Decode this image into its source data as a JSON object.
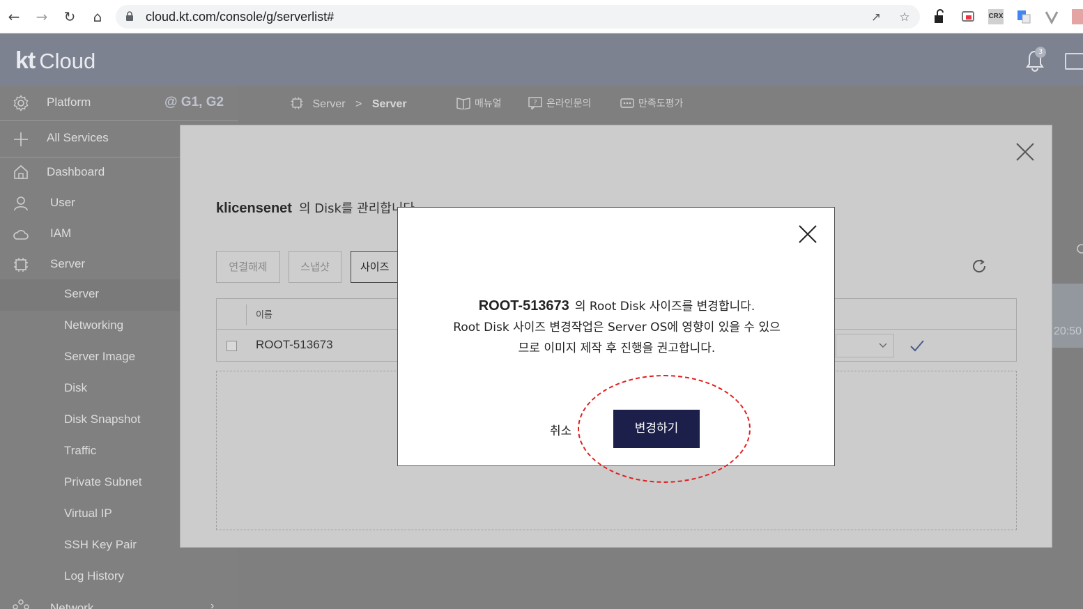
{
  "browser": {
    "url": "cloud.kt.com/console/g/serverlist#",
    "extensions": [
      "CRX"
    ]
  },
  "header": {
    "logo_kt": "kt",
    "logo_cloud": "Cloud",
    "notification_count": "3"
  },
  "sidebar": {
    "platform_label": "Platform",
    "platform_tag": "@ G1, G2",
    "all_services": "All Services",
    "items": [
      {
        "label": "Dashboard",
        "icon": "home-icon"
      },
      {
        "label": "User",
        "icon": "user-icon"
      },
      {
        "label": "IAM",
        "icon": "cloud-icon"
      },
      {
        "label": "Server",
        "icon": "chip-icon"
      }
    ],
    "server_sub": [
      "Server",
      "Networking",
      "Server Image",
      "Disk",
      "Disk Snapshot",
      "Traffic",
      "Private Subnet",
      "Virtual IP",
      "SSH Key Pair",
      "Log History"
    ],
    "network": "Network"
  },
  "main": {
    "crumb_root": "Server",
    "crumb_sep": ">",
    "crumb_current": "Server",
    "link_manual": "매뉴얼",
    "link_inquiry": "온라인문의",
    "link_survey": "만족도평가",
    "side_time": "20:50"
  },
  "disk_modal": {
    "server_name": "klicensenet",
    "title_suffix": "의 Disk를 관리합니다",
    "btn_detach": "연결해제",
    "btn_snapshot": "스냅샷",
    "btn_resize": "사이즈변경",
    "col_name": "이름",
    "row_name": "ROOT-513673"
  },
  "confirm": {
    "disk_name": "ROOT-513673",
    "line1": "의 Root Disk 사이즈를 변경합니다.",
    "line2": "Root Disk 사이즈 변경작업은 Server OS에 영향이 있을 수 있으",
    "line3": "므로 이미지 제작 후 진행을 권고합니다.",
    "cancel": "취소",
    "confirm": "변경하기"
  },
  "colors": {
    "confirm_button": "#1b1f4a",
    "highlight": "#e11e1e",
    "header": "#7d8290"
  }
}
